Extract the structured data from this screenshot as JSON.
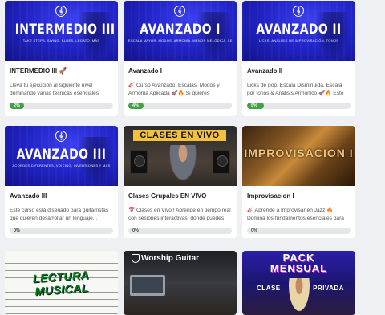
{
  "courses": [
    {
      "title": "INTERMEDIO III 🚀",
      "thumb_title": "INTERMEDIO III",
      "thumb_subtitle": "TAKE STEPS, SWING, BLUES, LEGATO, MÁS",
      "description": "Lleva tu ejecución al siguiente nivel dominando varias técnicas esenciales para...",
      "progress": 2,
      "progress_label": "2%"
    },
    {
      "title": "Avanzado I",
      "thumb_title": "AVANZADO I",
      "thumb_subtitle": "ESCALA MAYOR, MODOS, ARMONÍA, MENOR MELÓDICA, LEGATO",
      "description": "🎸 Curso Avanzado: Escalas, Modos y Armonía Aplicada 🚀🔥 Si quieres improvisa...",
      "progress": 4,
      "progress_label": "4%"
    },
    {
      "title": "Avanzado II",
      "thumb_title": "AVANZADO II",
      "thumb_subtitle": "LICKS, ANÁLISIS DE IMPROVISACIÓN, TONOS",
      "description": "Licks de pop, Escala Disminuida, Escala por tonos & Análisis Armónico 🚀🔥 Este curso...",
      "progress": 5,
      "progress_label": "5%"
    },
    {
      "title": "Avanzado III",
      "thumb_title": "AVANZADO III",
      "thumb_subtitle": "ACORDES DIFERENTES, VOICING, INVERSIONES Y MÁS",
      "description": "Este curso está diseñado para guitarristas que quieren desarrollar un lenguaje...",
      "progress": 0,
      "progress_label": "0%"
    },
    {
      "title": "Clases Grupales EN VIVO",
      "thumb_title": "CLASES EN VIVO",
      "description": "📅 Clases en Vivo!! Aprende en tiempo real con sesiones interactivas, donde puedes ve...",
      "progress": 0,
      "progress_label": "0%"
    },
    {
      "title": "Improvisacion I",
      "thumb_title": "IMPROVISACION I",
      "description": "🎸 Aprende a Improvisar en Jazz 🔥 Domina los fundamentos esenciales para improvisa...",
      "progress": 0,
      "progress_label": "0%"
    },
    {
      "thumb_title": "LECTURA MUSICAL"
    },
    {
      "thumb_title": "Worship Guitar"
    },
    {
      "thumb_title": "PACK MENSUAL",
      "thumb_left": "CLASE",
      "thumb_right": "PRIVADA"
    }
  ],
  "colors": {
    "progress_fill": "#43a047",
    "card_background": "#ffffff",
    "page_background": "#eef0f3"
  }
}
